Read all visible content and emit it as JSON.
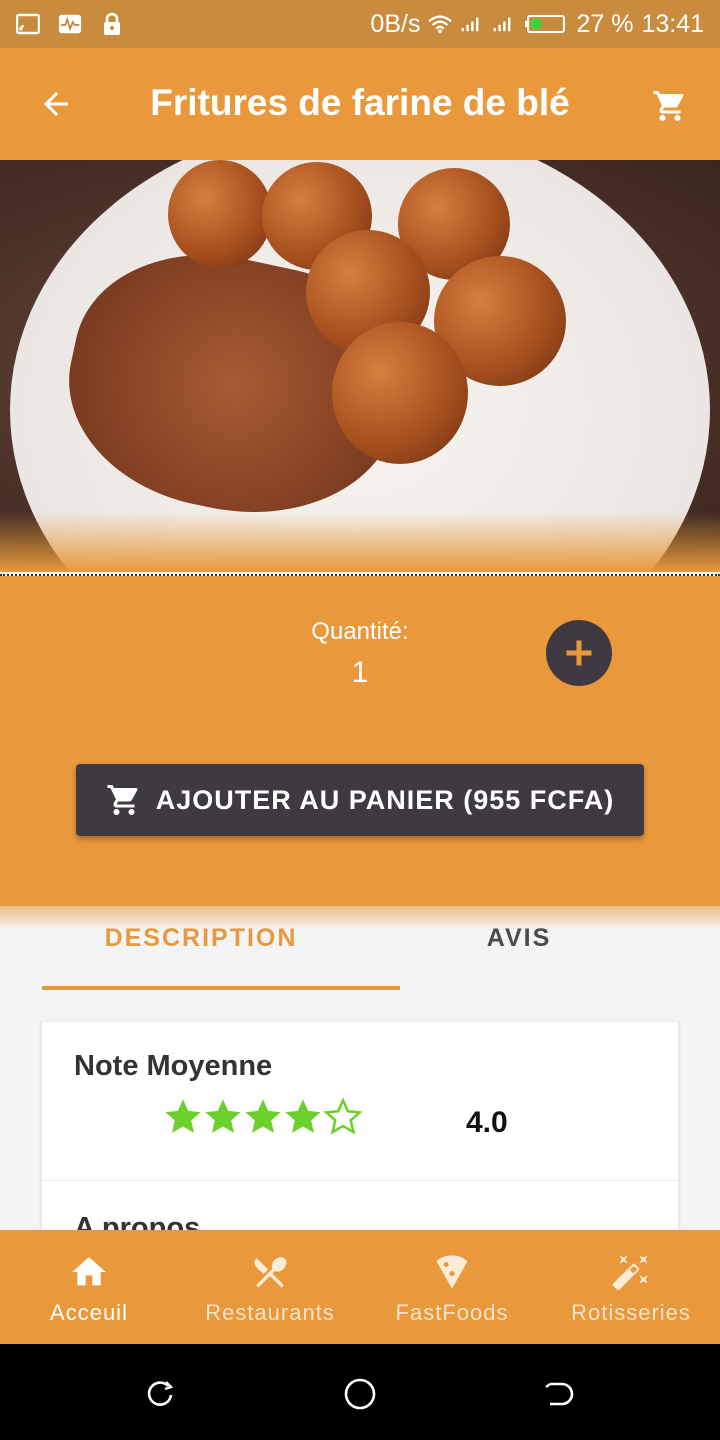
{
  "status_bar": {
    "net_speed": "0B/s",
    "battery": "27 %",
    "time": "13:41"
  },
  "app_bar": {
    "title": "Fritures de farine de blé",
    "back_icon": "arrow-left-icon",
    "cart_icon": "cart-icon"
  },
  "quantity": {
    "label": "Quantité:",
    "value": "1"
  },
  "add_to_cart": {
    "label": "AJOUTER AU PANIER (955 FCFA)"
  },
  "tabs": [
    {
      "label": "DESCRIPTION",
      "selected": true
    },
    {
      "label": "AVIS",
      "selected": false
    }
  ],
  "rating_card": {
    "heading": "Note Moyenne",
    "value": "4.0",
    "stars_filled": 4,
    "stars_total": 5,
    "star_color": "#6bd02a",
    "next_heading": "A propos"
  },
  "bottom_nav": [
    {
      "label": "Acceuil",
      "icon": "home-icon",
      "active": true
    },
    {
      "label": "Restaurants",
      "icon": "utensils-icon",
      "active": false
    },
    {
      "label": "FastFoods",
      "icon": "pizza-icon",
      "active": false
    },
    {
      "label": "Rotisseries",
      "icon": "magic-wand-icon",
      "active": false
    }
  ],
  "colors": {
    "primary": "#e9993b",
    "dark_button": "#3f3a42",
    "background": "#f3f4f6"
  }
}
